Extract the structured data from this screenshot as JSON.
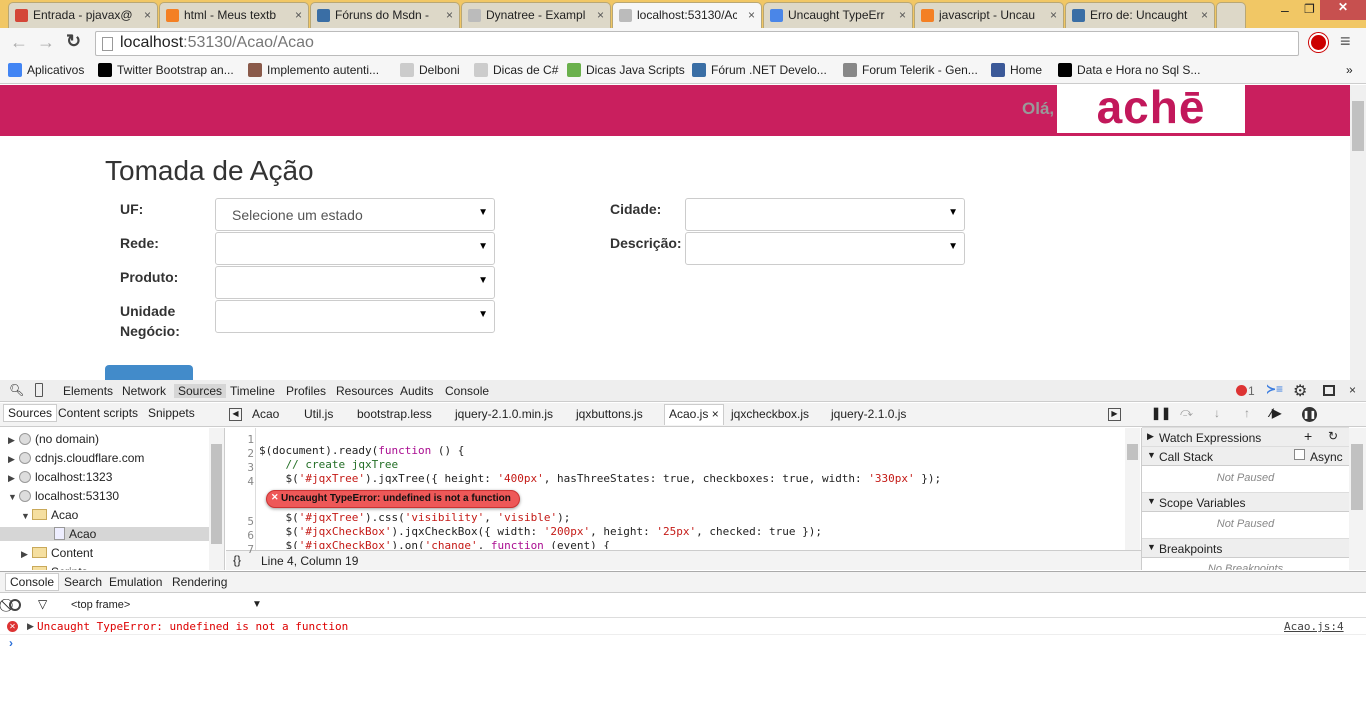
{
  "browser": {
    "tabs": [
      {
        "title": "Entrada - pjavax@",
        "icon": "gmail-icon",
        "color": "#d44638"
      },
      {
        "title": "html - Meus textb",
        "icon": "stackoverflow-icon",
        "color": "#f48024"
      },
      {
        "title": "Fóruns do Msdn -",
        "icon": "msdn-icon",
        "color": "#3a6ea5"
      },
      {
        "title": "Dynatree - Exampl",
        "icon": "page-icon",
        "color": "#bbb"
      },
      {
        "title": "localhost:53130/Ac",
        "icon": "page-icon",
        "color": "#bbb"
      },
      {
        "title": "Uncaught TypeErr",
        "icon": "google-icon",
        "color": "#4a86e8"
      },
      {
        "title": "javascript - Uncau",
        "icon": "stackoverflow-icon",
        "color": "#f48024"
      },
      {
        "title": "Erro de: Uncaught",
        "icon": "msdn-icon",
        "color": "#3a6ea5"
      }
    ],
    "active_tab": 4,
    "url_host": "localhost",
    "url_rest": ":53130/Acao/Acao",
    "bookmarks": [
      {
        "label": "Aplicativos",
        "color": "#4285f4"
      },
      {
        "label": "Twitter Bootstrap an...",
        "color": "#000"
      },
      {
        "label": "Implemento autenti...",
        "color": "#8a5a4a"
      },
      {
        "label": "Delboni",
        "color": "#ccc"
      },
      {
        "label": "Dicas de C#",
        "color": "#ccc"
      },
      {
        "label": "Dicas Java Scripts",
        "color": "#6ab04c"
      },
      {
        "label": "Fórum .NET Develo...",
        "color": "#3a6ea5"
      },
      {
        "label": "Forum Telerik - Gen...",
        "color": "#888"
      },
      {
        "label": "Home",
        "color": "#3b5998"
      },
      {
        "label": "Data e Hora no Sql S...",
        "color": "#000"
      }
    ],
    "more": "»"
  },
  "page": {
    "greeting": "Olá,",
    "logo": "achē",
    "brand_color": "#c91f5e",
    "title": "Tomada de Ação",
    "fields": {
      "uf_label": "UF:",
      "uf_value": "Selecione um estado",
      "rede_label": "Rede:",
      "produto_label": "Produto:",
      "unidade_label1": "Unidade",
      "unidade_label2": "Negócio:",
      "cidade_label": "Cidade:",
      "descricao_label": "Descrição:"
    }
  },
  "devtools": {
    "tabs": [
      "Elements",
      "Network",
      "Sources",
      "Timeline",
      "Profiles",
      "Resources",
      "Audits",
      "Console"
    ],
    "active": "Sources",
    "error_count": "1",
    "nav_tabs": [
      "Sources",
      "Content scripts",
      "Snippets"
    ],
    "tree": [
      "(no domain)",
      "cdnjs.cloudflare.com",
      "localhost:1323",
      "localhost:53130",
      "Acao",
      "Acao",
      "Content",
      "Scripts"
    ],
    "files": [
      "Acao",
      "Util.js",
      "bootstrap.less",
      "jquery-2.1.0.min.js",
      "jqxbuttons.js",
      "Acao.js",
      "jqxcheckbox.js",
      "jquery-2.1.0.js"
    ],
    "lines": [
      "1",
      "2",
      "3",
      "4",
      "5",
      "6",
      "7"
    ],
    "error_bubble": "Uncaught TypeError: undefined is not a function",
    "status": "Line 4, Column 19",
    "sections": {
      "watch": "Watch Expressions",
      "callstack": "Call Stack",
      "async": "Async",
      "not_paused1": "Not Paused",
      "scope": "Scope Variables",
      "not_paused2": "Not Paused",
      "breakpoints": "Breakpoints",
      "no_breakpoints": "No Breakpoints"
    },
    "drawer_tabs": [
      "Console",
      "Search",
      "Emulation",
      "Rendering"
    ],
    "frame": "<top frame>",
    "console_error": "Uncaught TypeError: undefined is not a function",
    "console_source": "Acao.js:4",
    "prompt": "›"
  }
}
